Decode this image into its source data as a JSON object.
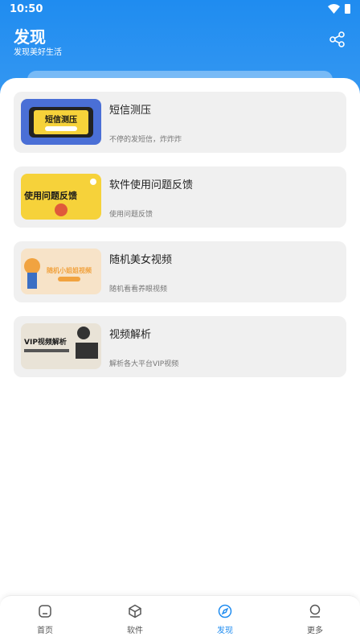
{
  "status": {
    "time": "10:50"
  },
  "header": {
    "title": "发现",
    "subtitle": "发现美好生活",
    "share_icon": "share-icon"
  },
  "cards": [
    {
      "title": "短信测压",
      "desc": "不停的发短信，炸炸炸",
      "thumb_text": "短信测压"
    },
    {
      "title": "软件使用问题反馈",
      "desc": "使用问题反馈",
      "thumb_text": "使用问题反馈"
    },
    {
      "title": "随机美女视频",
      "desc": "随机看看养眼视频",
      "thumb_text": "随机小姐姐视频"
    },
    {
      "title": "视频解析",
      "desc": "解析各大平台VIP视频",
      "thumb_text": "VIP视频解析"
    }
  ],
  "nav": [
    {
      "label": "首页",
      "icon": "home-icon",
      "active": false
    },
    {
      "label": "软件",
      "icon": "cube-icon",
      "active": false
    },
    {
      "label": "发现",
      "icon": "compass-icon",
      "active": true
    },
    {
      "label": "更多",
      "icon": "user-icon",
      "active": false
    }
  ],
  "colors": {
    "accent": "#1f8cf0",
    "card_bg": "#f0f0f0"
  }
}
